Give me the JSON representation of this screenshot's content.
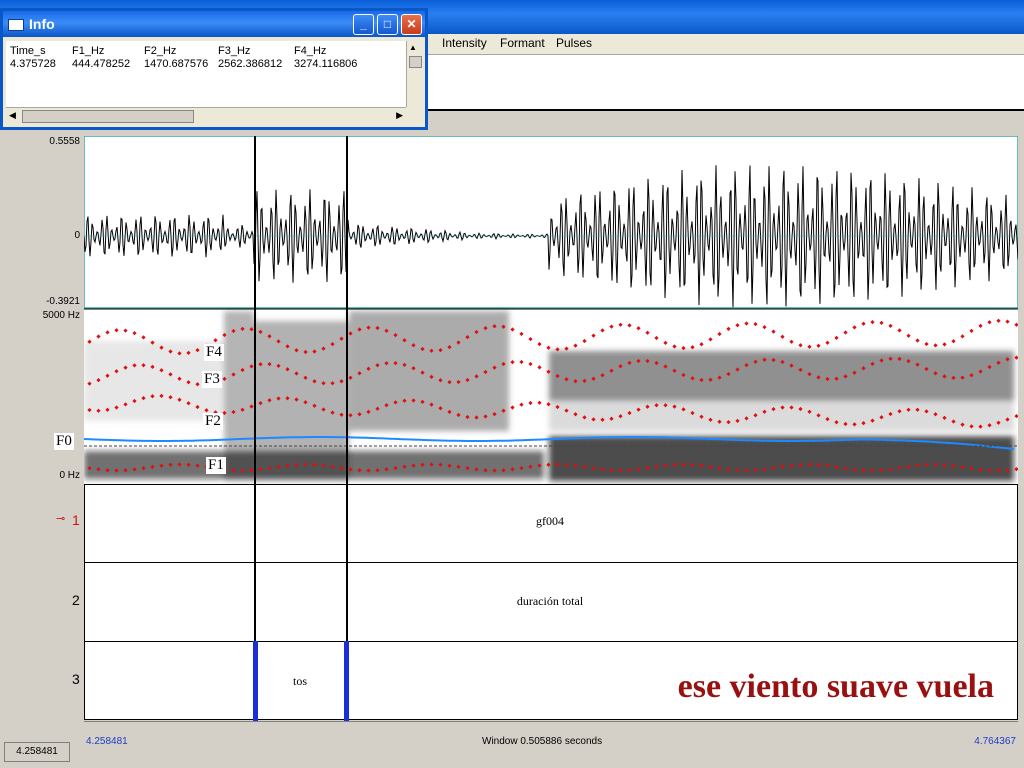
{
  "menu": {
    "items": [
      "Intensity",
      "Formant",
      "Pulses"
    ]
  },
  "info_window": {
    "title": "Info",
    "headers": [
      "Time_s",
      "F1_Hz",
      "F2_Hz",
      "F3_Hz",
      "F4_Hz"
    ],
    "values": [
      "4.375728",
      "444.478252",
      "1470.687576",
      "2562.386812",
      "3274.116806"
    ]
  },
  "waveform": {
    "max_label": "0.5558",
    "zero_label": "0",
    "min_label": "-0.3921"
  },
  "spectrogram": {
    "top_label": "5000 Hz",
    "bottom_label": "0 Hz",
    "f0_label": "F0",
    "formant_labels": [
      "F4",
      "F3",
      "F2",
      "F1"
    ]
  },
  "tiers": [
    {
      "number": "1",
      "text": "gf004"
    },
    {
      "number": "2",
      "text": "duración total"
    },
    {
      "number": "3",
      "text": "tos"
    }
  ],
  "bottom": {
    "start_time": "4.258481",
    "window_text": "Window 0.505886 seconds",
    "end_time": "4.764367",
    "status_value": "4.258481"
  },
  "caption": "ese viento suave vuela",
  "colors": {
    "formant_points": "#e01010",
    "pitch_line": "#1a8cff",
    "caption": "#9a1010",
    "boundary": "#1a2fd8"
  }
}
